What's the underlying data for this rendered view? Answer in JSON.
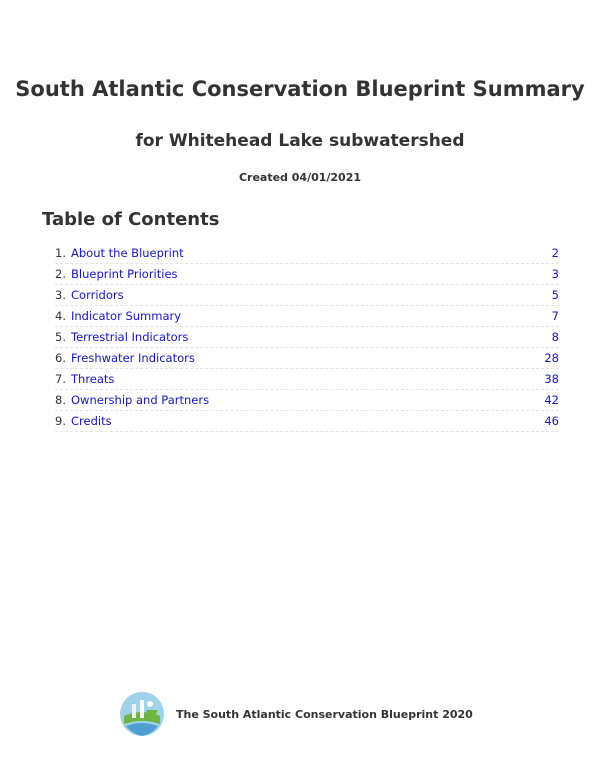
{
  "document": {
    "title": "South Atlantic Conservation Blueprint Summary",
    "subtitle": "for Whitehead Lake subwatershed",
    "created": "Created 04/01/2021"
  },
  "toc": {
    "heading": "Table of Contents",
    "items": [
      {
        "num": "1.",
        "label": "About the Blueprint",
        "page": "2"
      },
      {
        "num": "2.",
        "label": "Blueprint Priorities",
        "page": "3"
      },
      {
        "num": "3.",
        "label": "Corridors",
        "page": "5"
      },
      {
        "num": "4.",
        "label": "Indicator Summary",
        "page": "7"
      },
      {
        "num": "5.",
        "label": "Terrestrial Indicators",
        "page": "8"
      },
      {
        "num": "6.",
        "label": "Freshwater Indicators",
        "page": "28"
      },
      {
        "num": "7.",
        "label": "Threats",
        "page": "38"
      },
      {
        "num": "8.",
        "label": "Ownership and Partners",
        "page": "42"
      },
      {
        "num": "9.",
        "label": "Credits",
        "page": "46"
      }
    ]
  },
  "footer": {
    "text": "The South Atlantic Conservation Blueprint 2020",
    "logo_icon": "blueprint-logo-icon"
  },
  "colors": {
    "text": "#333333",
    "link": "#1515d1",
    "logo_sky": "#9fd3ec",
    "logo_green": "#6fb544"
  }
}
